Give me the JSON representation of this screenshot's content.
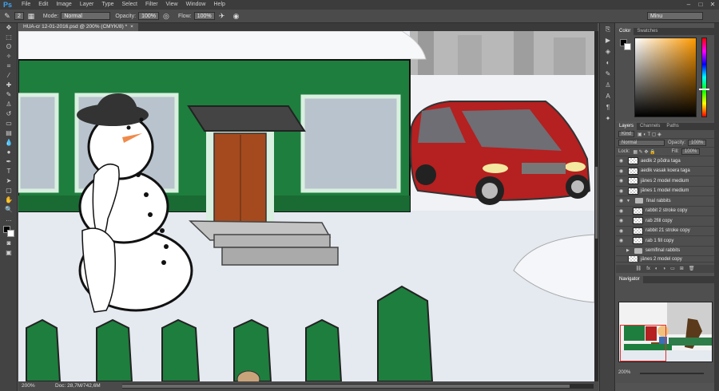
{
  "menubar": {
    "logo": "Ps",
    "items": [
      "File",
      "Edit",
      "Image",
      "Layer",
      "Type",
      "Select",
      "Filter",
      "View",
      "Window",
      "Help"
    ],
    "window_controls": [
      "–",
      "□",
      "✕"
    ]
  },
  "options_bar": {
    "brush_size": "2",
    "mode_label": "Mode:",
    "mode_value": "Normal",
    "opacity_label": "Opacity:",
    "opacity_value": "100%",
    "flow_label": "Flow:",
    "flow_value": "100%",
    "workspace": "Minu"
  },
  "document": {
    "tab_label": "HUA-cr 12-01-2016.psd @ 200% (CMYK/8) *",
    "close": "×"
  },
  "status_bar": {
    "zoom": "200%",
    "doc_size": "Doc: 28,7M/742,6M"
  },
  "color_panel": {
    "tabs": [
      "Color",
      "Swatches"
    ],
    "foreground": "#000000",
    "background": "#ffffff"
  },
  "layers_panel": {
    "tabs": [
      "Layers",
      "Channels",
      "Paths"
    ],
    "filter_label": "Kind",
    "blend_mode": "Normal",
    "opacity_label": "Opacity:",
    "opacity_value": "100%",
    "lock_label": "Lock:",
    "fill_label": "Fill:",
    "fill_value": "100%",
    "layers": [
      {
        "name": "aedik 2 põdra taga",
        "type": "layer"
      },
      {
        "name": "aedik vasak koera taga",
        "type": "layer"
      },
      {
        "name": "jänes 2 model medium",
        "type": "layer"
      },
      {
        "name": "jänes 1 model medium",
        "type": "layer"
      },
      {
        "name": "final rabbits",
        "type": "group-open"
      },
      {
        "name": "rabbit 2 stroke copy",
        "type": "child"
      },
      {
        "name": "rab 2fill copy",
        "type": "child"
      },
      {
        "name": "rabbit 21 stroke copy",
        "type": "child"
      },
      {
        "name": "rab 1 fill copy",
        "type": "child"
      },
      {
        "name": "semifinal rabbits",
        "type": "group-closed"
      },
      {
        "name": "jänes 2 model copy",
        "type": "layer"
      }
    ]
  },
  "navigator_panel": {
    "tab": "Navigator",
    "zoom": "200%"
  },
  "tools": [
    "move-tool",
    "marquee-tool",
    "lasso-tool",
    "quick-select-tool",
    "crop-tool",
    "eyedropper-tool",
    "healing-tool",
    "brush-tool",
    "stamp-tool",
    "history-brush-tool",
    "eraser-tool",
    "gradient-tool",
    "blur-tool",
    "dodge-tool",
    "pen-tool",
    "type-tool",
    "path-select-tool",
    "shape-tool",
    "hand-tool",
    "zoom-tool"
  ]
}
